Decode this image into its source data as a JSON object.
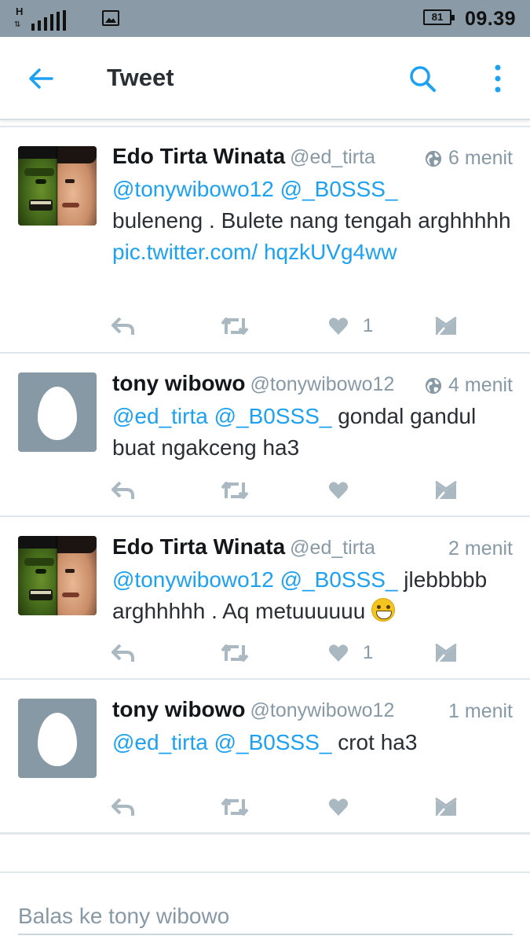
{
  "status_bar": {
    "network_type": "H",
    "battery": "81",
    "clock": "09.39",
    "icons": [
      "network-type-icon",
      "signal-icon",
      "gallery-notification-icon",
      "battery-icon"
    ]
  },
  "app_bar": {
    "title": "Tweet",
    "icons": [
      "back-arrow-icon",
      "search-icon",
      "more-vertical-icon"
    ]
  },
  "colors": {
    "accent": "#1da1f2",
    "secondary_text": "#8899a6",
    "status_bar": "#8a9aa6"
  },
  "tweets": [
    {
      "name": "Edo Tirta Winata",
      "handle": "@ed_tirta",
      "time": "6 menit",
      "has_globe": true,
      "avatar": "hulk-face-split",
      "body": {
        "mention1": "@tonywibowo12",
        "mention2": "@_B0SSS_",
        "text1": "buleneng . Bulete nang tengah arghhhhh",
        "link": "pic.twitter.com/ hqzkUVg4ww"
      },
      "like_count": "1"
    },
    {
      "name": "tony wibowo",
      "handle": "@tonywibowo12",
      "time": "4 menit",
      "has_globe": true,
      "avatar": "default-egg",
      "body": {
        "mention1": "@ed_tirta",
        "mention2": "@_B0SSS_",
        "text1": "gondal gandul buat ngakceng ha3"
      },
      "like_count": ""
    },
    {
      "name": "Edo Tirta Winata",
      "handle": "@ed_tirta",
      "time": "2 menit",
      "has_globe": false,
      "avatar": "hulk-face-split",
      "body": {
        "mention1": "@tonywibowo12",
        "mention2": "@_B0SSS_",
        "text1": "jlebbbbb arghhhhh . Aq metuuuuuu",
        "emoji": "grinning-face-emoji"
      },
      "like_count": "1"
    },
    {
      "name": "tony wibowo",
      "handle": "@tonywibowo12",
      "time": "1 menit",
      "has_globe": false,
      "avatar": "default-egg",
      "body": {
        "mention1": "@ed_tirta",
        "mention2": "@_B0SSS_",
        "text1": "crot ha3"
      },
      "like_count": ""
    }
  ],
  "action_icons": [
    "reply-icon",
    "retweet-icon",
    "like-icon",
    "direct-message-icon"
  ],
  "reply": {
    "placeholder": "Balas ke tony wibowo",
    "value": ""
  }
}
